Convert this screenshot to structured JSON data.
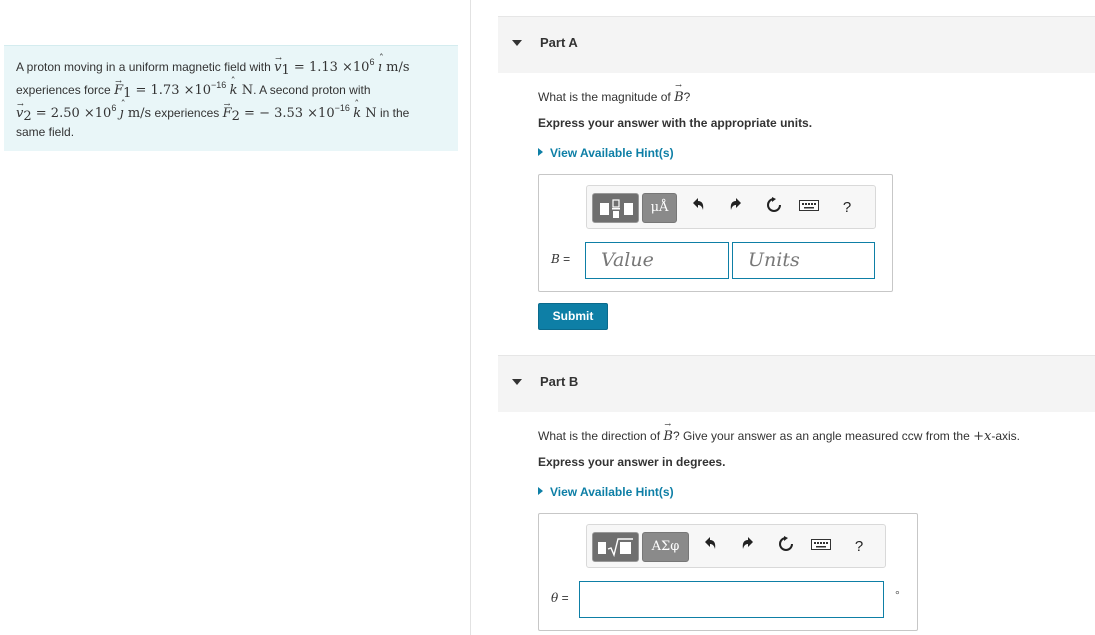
{
  "problem": {
    "intro": "A proton moving in a uniform magnetic field with ",
    "v1_sym": "v",
    "v1_sub": "1",
    "v1_eq": " = 1.13 ×10",
    "v1_exp": "6",
    "v1_unit_vec": "ı",
    "v1_unit": " m/s",
    "l2_a": "experiences force ",
    "f1_sym": "F",
    "f1_sub": "1",
    "f1_eq": " = 1.73 ×10",
    "f1_exp": "−16",
    "f1_unit_vec": "k",
    "f1_unit": " N",
    "l2_b": ". A second proton with",
    "v2_sym": "v",
    "v2_sub": "2",
    "v2_eq": " = 2.50 ×10",
    "v2_exp": "6",
    "v2_unit_vec": "ȷ",
    "v2_unit": " m/s",
    "l3_a": " experiences ",
    "f2_sym": "F",
    "f2_sub": "2",
    "f2_eq": " = − 3.53 ×10",
    "f2_exp": "−16",
    "f2_unit_vec": "k",
    "f2_unit": " N",
    "l3_b": " in the",
    "l4": "same field."
  },
  "partA": {
    "title": "Part A",
    "question_pre": "What is the magnitude of ",
    "question_sym": "B",
    "question_post": "?",
    "instruction": "Express your answer with the appropriate units.",
    "hint": "View Available Hint(s)",
    "toolbar": {
      "units_btn": "μÅ",
      "help": "?"
    },
    "field_label_sym": "B",
    "field_label_eq": " =",
    "value_placeholder": "Value",
    "units_placeholder": "Units",
    "submit": "Submit"
  },
  "partB": {
    "title": "Part B",
    "question_pre": "What is the direction of ",
    "question_sym": "B",
    "question_mid": "? Give your answer as an angle measured ccw from the ",
    "question_axis": "+x",
    "question_post": "-axis.",
    "instruction": "Express your answer in degrees.",
    "hint": "View Available Hint(s)",
    "toolbar": {
      "greek_btn": "ΑΣφ",
      "help": "?"
    },
    "field_label_sym": "θ",
    "field_label_eq": " =",
    "unit_suffix": "°"
  },
  "colors": {
    "accent": "#0e7fa6",
    "problem_bg": "#e9f6f8",
    "header_bg": "#f4f4f4"
  },
  "icons": [
    "undo-icon",
    "redo-icon",
    "reset-icon",
    "keyboard-icon",
    "help-icon",
    "caret-down-icon",
    "caret-right-icon",
    "fraction-template-icon",
    "sqrt-template-icon"
  ]
}
